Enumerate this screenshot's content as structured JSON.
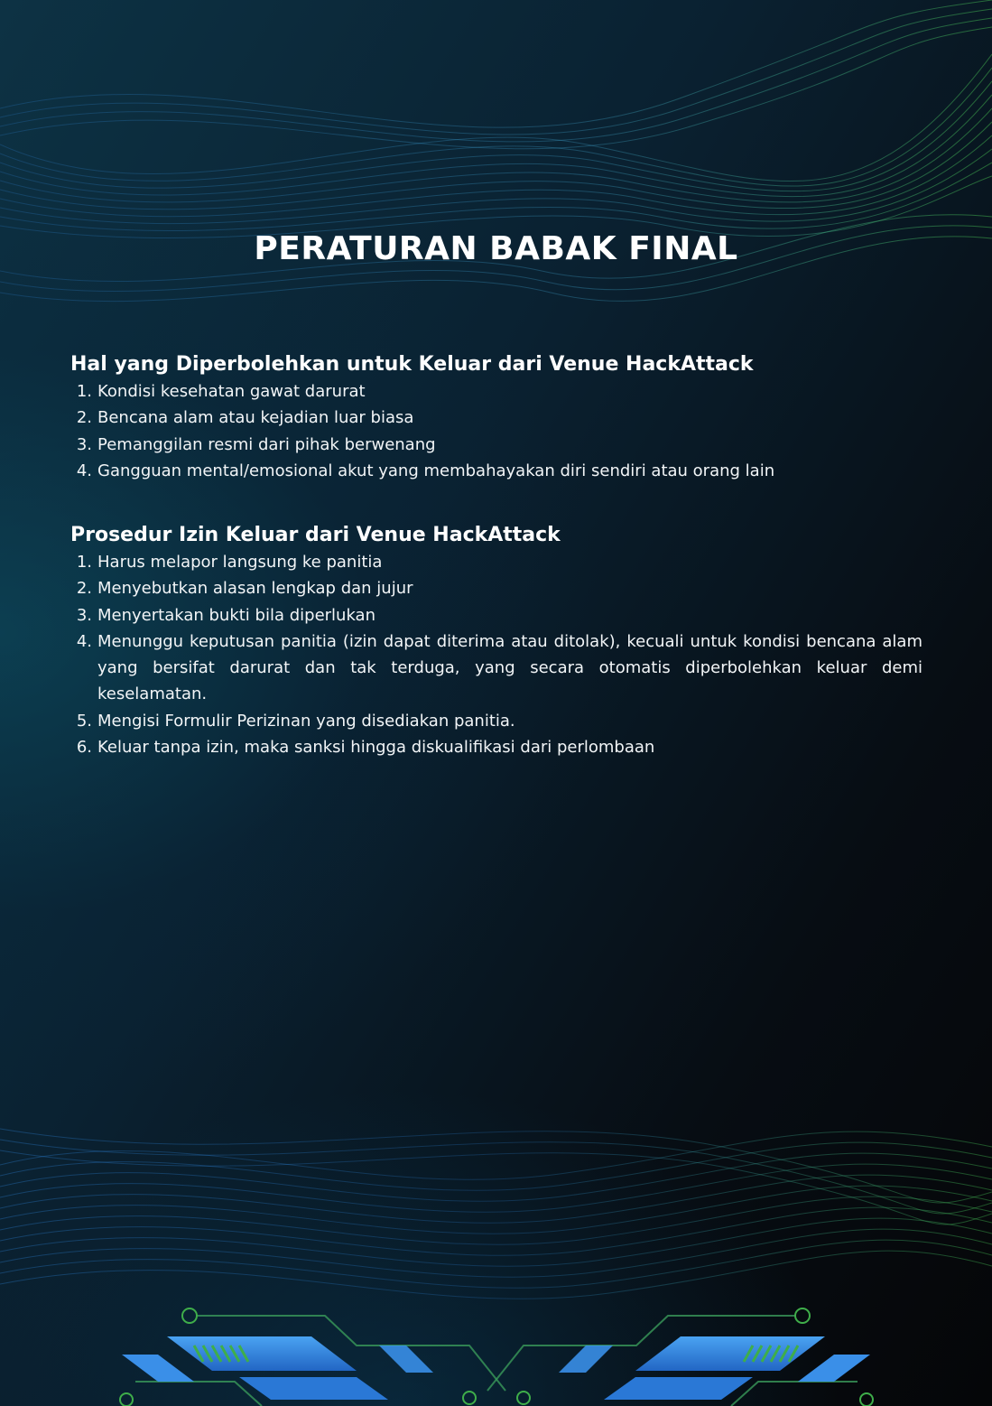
{
  "title": "PERATURAN BABAK FINAL",
  "sections": [
    {
      "heading": "Hal yang Diperbolehkan untuk Keluar dari Venue HackAttack",
      "items": [
        {
          "num": "1.",
          "text": "Kondisi kesehatan gawat darurat"
        },
        {
          "num": "2.",
          "text": "Bencana alam atau kejadian luar biasa"
        },
        {
          "num": "3.",
          "text": "Pemanggilan resmi dari pihak berwenang"
        },
        {
          "num": "4.",
          "text": "Gangguan mental/emosional akut yang membahayakan diri sendiri atau orang lain"
        }
      ]
    },
    {
      "heading": "Prosedur Izin Keluar dari Venue HackAttack",
      "items": [
        {
          "num": "1.",
          "text": "Harus melapor langsung ke panitia"
        },
        {
          "num": "2.",
          "text": "Menyebutkan alasan lengkap dan jujur"
        },
        {
          "num": "3.",
          "text": "Menyertakan bukti bila diperlukan"
        },
        {
          "num": "4.",
          "text": "Menunggu keputusan panitia (izin dapat diterima atau ditolak), kecuali untuk kondisi bencana alam yang bersifat darurat dan tak terduga, yang secara otomatis diperbolehkan keluar demi keselamatan."
        },
        {
          "num": "5.",
          "text": "Mengisi Formulir Perizinan yang disediakan panitia."
        },
        {
          "num": "6.",
          "text": "Keluar tanpa izin, maka sanksi hingga diskualifikasi dari perlombaan"
        }
      ]
    }
  ],
  "colors": {
    "background_dark": "#050608",
    "background_teal": "#0d3244",
    "wave_green": "#3fae4a",
    "wave_blue": "#2a7fd4",
    "circuit_blue": "#3a8fe8",
    "text": "#ffffff"
  }
}
